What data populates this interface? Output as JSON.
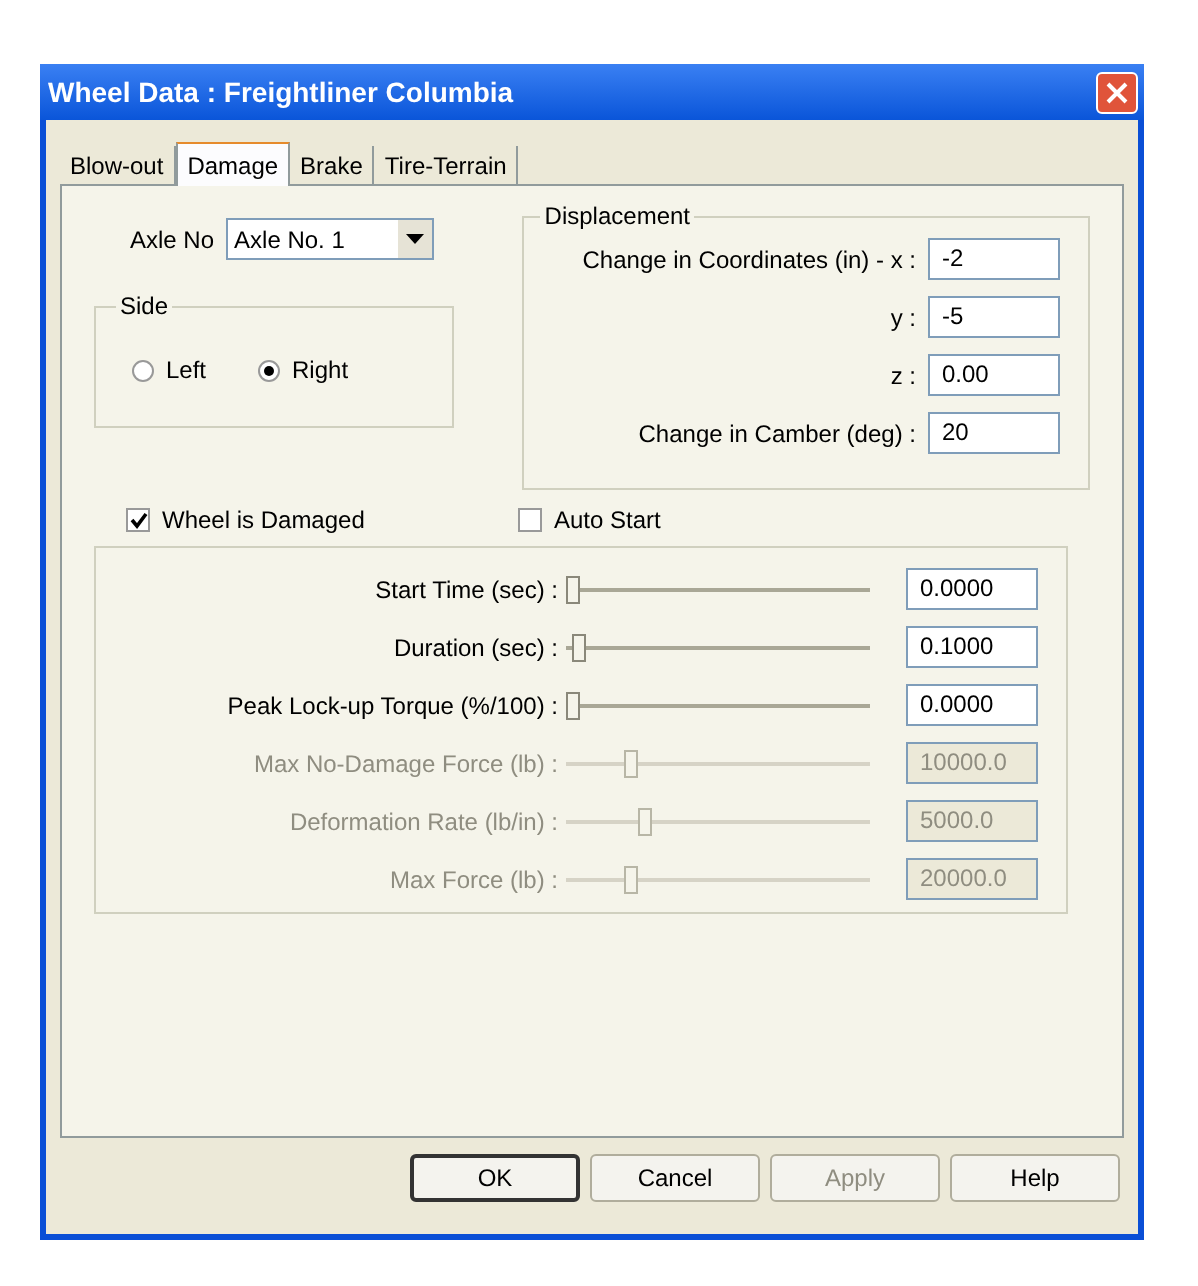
{
  "window": {
    "title": "Wheel Data : Freightliner Columbia"
  },
  "tabs": [
    {
      "label": "Blow-out",
      "selected": false
    },
    {
      "label": "Damage",
      "selected": true
    },
    {
      "label": "Brake",
      "selected": false
    },
    {
      "label": "Tire-Terrain",
      "selected": false
    }
  ],
  "axle": {
    "label": "Axle No",
    "value": "Axle No. 1"
  },
  "side": {
    "title": "Side",
    "options": [
      {
        "label": "Left",
        "selected": false
      },
      {
        "label": "Right",
        "selected": true
      }
    ]
  },
  "displacement": {
    "title": "Displacement",
    "fields": [
      {
        "label": "Change in Coordinates (in) - x :",
        "value": "-2"
      },
      {
        "label": "y :",
        "value": "-5"
      },
      {
        "label": "z :",
        "value": "0.00"
      },
      {
        "label": "Change in Camber (deg) :",
        "value": "20"
      }
    ]
  },
  "checkboxes": [
    {
      "label": "Wheel is Damaged",
      "checked": true
    },
    {
      "label": "Auto Start",
      "checked": false
    }
  ],
  "sliders": [
    {
      "label": "Start Time (sec) :",
      "level": 0,
      "value": "0.0000",
      "disabled": false
    },
    {
      "label": "Duration (sec) :",
      "level": 0.02,
      "value": "0.1000",
      "disabled": false
    },
    {
      "label": "Peak Lock-up Torque (%/100) :",
      "level": 0,
      "value": "0.0000",
      "disabled": false
    },
    {
      "label": "Max No-Damage Force (lb) :",
      "level": 0.2,
      "value": "10000.0",
      "disabled": true
    },
    {
      "label": "Deformation Rate (lb/in) :",
      "level": 0.25,
      "value": "5000.0",
      "disabled": true
    },
    {
      "label": "Max Force (lb) :",
      "level": 0.2,
      "value": "20000.0",
      "disabled": true
    }
  ],
  "buttons": [
    {
      "label": "OK",
      "disabled": false,
      "default": true
    },
    {
      "label": "Cancel",
      "disabled": false,
      "default": false
    },
    {
      "label": "Apply",
      "disabled": true,
      "default": false
    },
    {
      "label": "Help",
      "disabled": false,
      "default": false
    }
  ]
}
